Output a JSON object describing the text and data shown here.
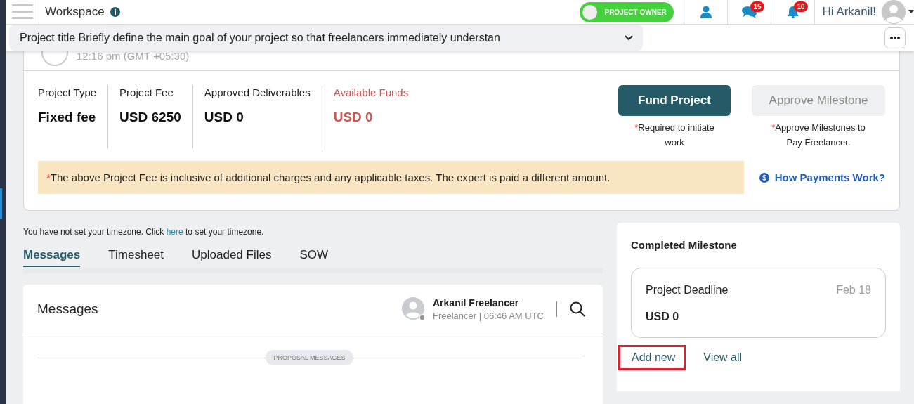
{
  "header": {
    "title": "Workspace",
    "role_toggle": {
      "label": "PROJECT OWNER",
      "on": true
    },
    "messages_badge": "15",
    "notifications_badge": "10",
    "greeting": "Hi Arkanil!"
  },
  "project_selector": {
    "value": "Project title Briefly define the main goal of your project so that freelancers immediately understan"
  },
  "owner_time": "12:16 pm (GMT +05:30)",
  "stats": [
    {
      "label": "Project Type",
      "value": "Fixed fee",
      "alert": false
    },
    {
      "label": "Project Fee",
      "value": "USD 6250",
      "alert": false
    },
    {
      "label": "Approved Deliverables",
      "value": "USD 0",
      "alert": false
    },
    {
      "label": "Available Funds",
      "value": "USD 0",
      "alert": true
    }
  ],
  "actions": [
    {
      "label": "Fund Project",
      "disabled": false,
      "note_marker": "*",
      "note": "Required to initiate work"
    },
    {
      "label": "Approve Milestone",
      "disabled": true,
      "note_marker": "*",
      "note": "Approve Milestones to Pay Freelancer."
    }
  ],
  "notice_marker": "*",
  "notice": "The above Project Fee is inclusive of additional charges and any applicable taxes. The expert is paid a different amount.",
  "payments_link": "How Payments Work?",
  "timezone_note": {
    "before": "You have not set your timezone. Click",
    "link": "here",
    "after": "to set your timezone."
  },
  "tabs": [
    {
      "label": "Messages",
      "selected": true
    },
    {
      "label": "Timesheet",
      "selected": false
    },
    {
      "label": "Uploaded Files",
      "selected": false
    },
    {
      "label": "SOW",
      "selected": false
    }
  ],
  "messages": {
    "title": "Messages",
    "contact_name": "Arkanil Freelancer",
    "contact_status": "Freelancer | 06:46 AM UTC",
    "divider_label": "PROPOSAL MESSAGES"
  },
  "milestones": {
    "title": "Completed Milestone",
    "items": [
      {
        "name": "Project Deadline",
        "date": "Feb 18",
        "amount": "USD 0"
      }
    ],
    "links": [
      {
        "label": "Add new",
        "highlighted": true
      },
      {
        "label": "View all",
        "highlighted": false
      }
    ]
  }
}
